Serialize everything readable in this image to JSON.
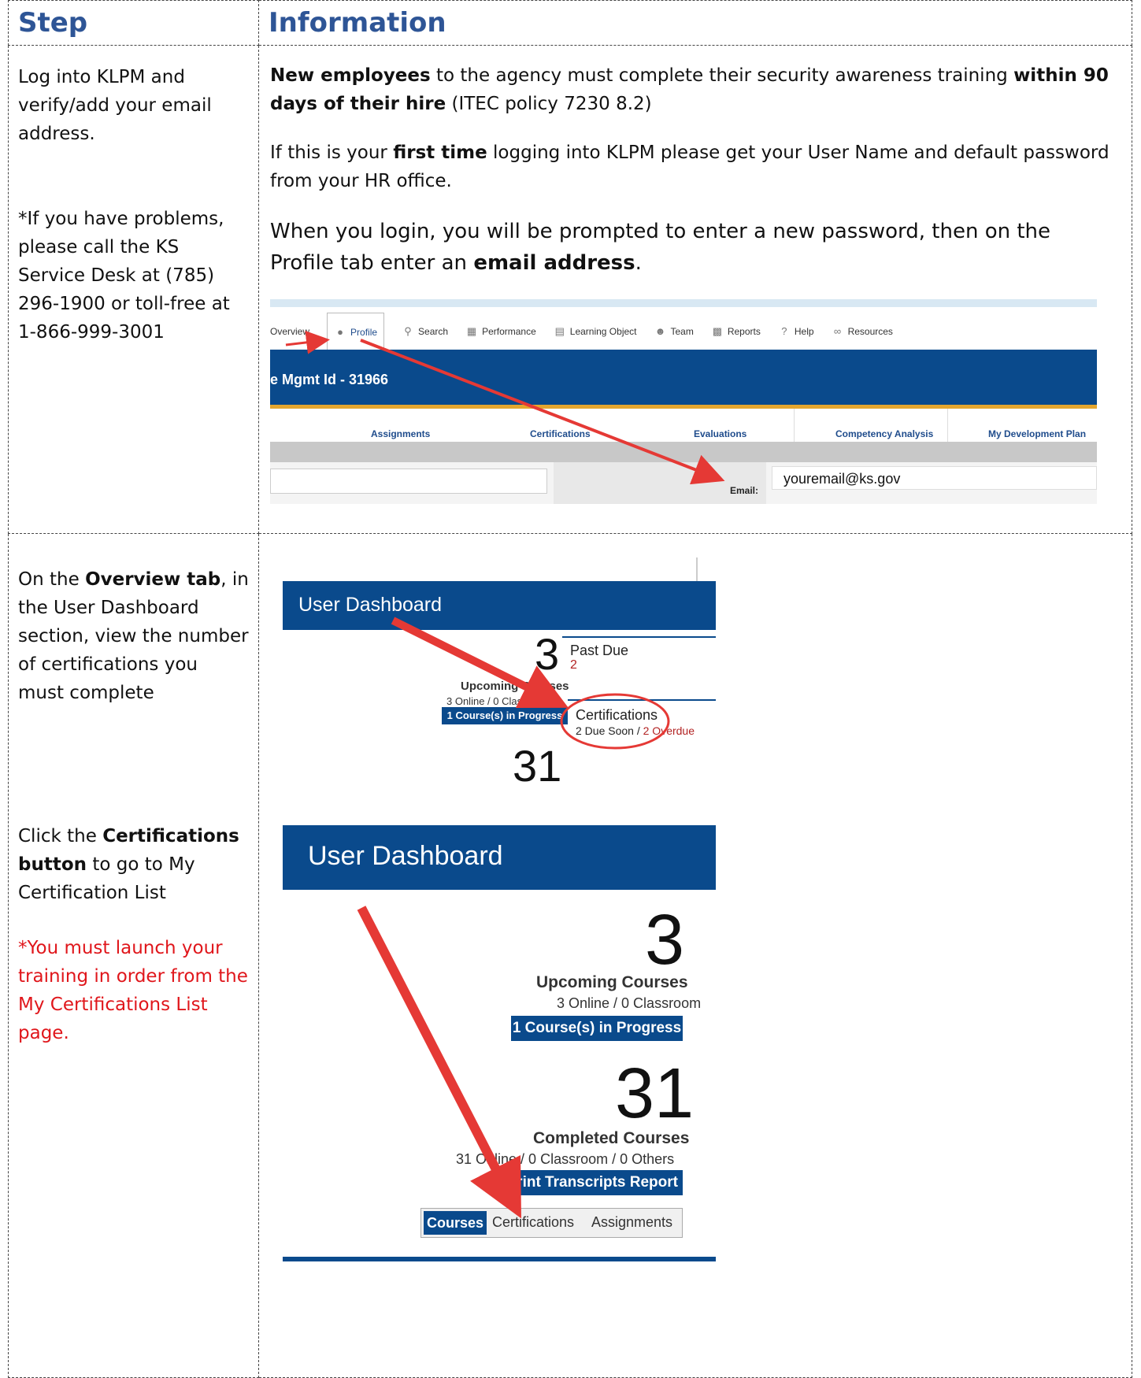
{
  "header": {
    "step": "Step",
    "information": "Information"
  },
  "row1": {
    "step_p1": "Log into KLPM and verify/add your email address.",
    "step_p2": "*If you have problems, please call the KS Service Desk at (785) 296-1900 or toll-free at 1-866-999-3001",
    "info_p1_b1": "New employees",
    "info_p1_t1": " to the agency must complete their security awareness training ",
    "info_p1_b2": "within 90 days of their hire",
    "info_p1_t2": " (ITEC policy 7230 8.2)",
    "info_p2_t1": "If this is your ",
    "info_p2_b1": "first time",
    "info_p2_t2": " logging into KLPM please get your User Name and default password from your HR office.",
    "info_p3_t1": "When you login, you will be prompted to enter a new password, then on the Profile tab enter an ",
    "info_p3_b1": "email address",
    "info_p3_t2": ".",
    "screenshot": {
      "nav": [
        "Overview",
        "Profile",
        "Search",
        "Performance",
        "Learning Object",
        "Team",
        "Reports",
        "Help",
        "Resources"
      ],
      "banner": "e Mgmt Id - 31966",
      "tabs": [
        "Assignments",
        "Certifications",
        "Evaluations",
        "Competency Analysis",
        "My Development Plan"
      ],
      "email_label": "Email:",
      "email_value": "youremail@ks.gov"
    }
  },
  "row2": {
    "step_b": "Overview tab",
    "step_t1": "On the ",
    "step_t2": ", in the User Dashboard section, view the number of certifications you must complete",
    "screenshot": {
      "title": "User Dashboard",
      "upcoming_num": "3",
      "upcoming_label": "Upcoming Courses",
      "upcoming_sub": "3 Online / 0 Classroom",
      "in_progress": "1 Course(s) in Progress",
      "past_due": "Past Due",
      "past_due_num": "2",
      "certifications": "Certifications",
      "cert_due": "2 Due Soon / ",
      "cert_overdue": "2 Overdue",
      "completed_num": "31"
    }
  },
  "row3": {
    "step_t1": "Click the ",
    "step_b": "Certifications button",
    "step_t2": " to go to My Certification List",
    "step_red": "*You must launch your training in order from the My Certifications List page.",
    "screenshot": {
      "title": "User Dashboard",
      "upcoming_num": "3",
      "upcoming_label": "Upcoming Courses",
      "upcoming_sub": "3 Online / 0 Classroom",
      "in_progress": "1 Course(s) in Progress",
      "completed_num": "31",
      "completed_label": "Completed Courses",
      "completed_sub": "31 Online / 0 Classroom / 0 Others",
      "print": "Print Transcripts Report",
      "tab_courses": "Courses",
      "tab_certifications": "Certifications",
      "tab_assignments": "Assignments"
    }
  }
}
